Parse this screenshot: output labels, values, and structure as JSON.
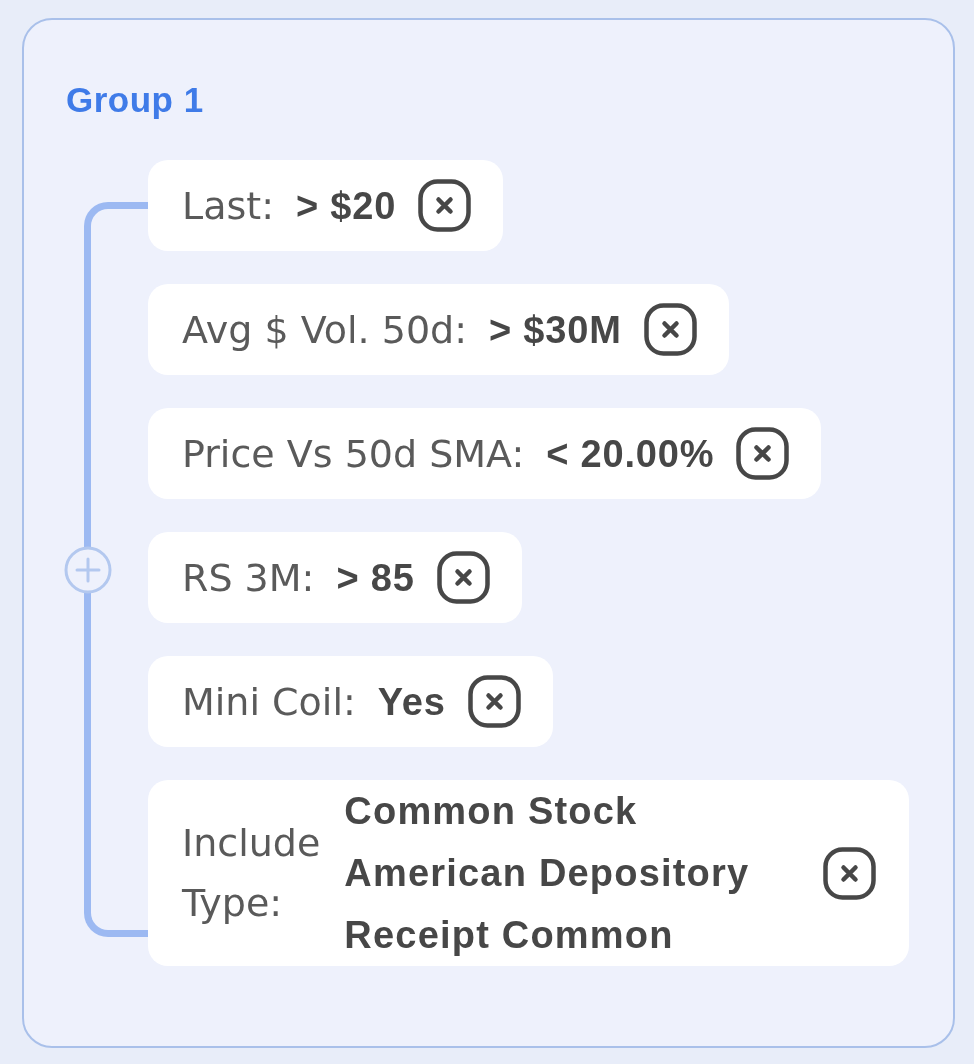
{
  "group": {
    "title": "Group 1",
    "filters": [
      {
        "kind": "single",
        "label": "Last:",
        "value": "> $20"
      },
      {
        "kind": "single",
        "label": "Avg $ Vol. 50d:",
        "value": "> $30M"
      },
      {
        "kind": "single",
        "label": "Price Vs 50d SMA:",
        "value": "< 20.00%"
      },
      {
        "kind": "single",
        "label": "RS 3M:",
        "value": "> 85"
      },
      {
        "kind": "single",
        "label": "Mini Coil:",
        "value": "Yes"
      },
      {
        "kind": "multi",
        "label": "Include Type:",
        "values": [
          "Common Stock",
          "American Depository Receipt Common"
        ]
      }
    ]
  }
}
